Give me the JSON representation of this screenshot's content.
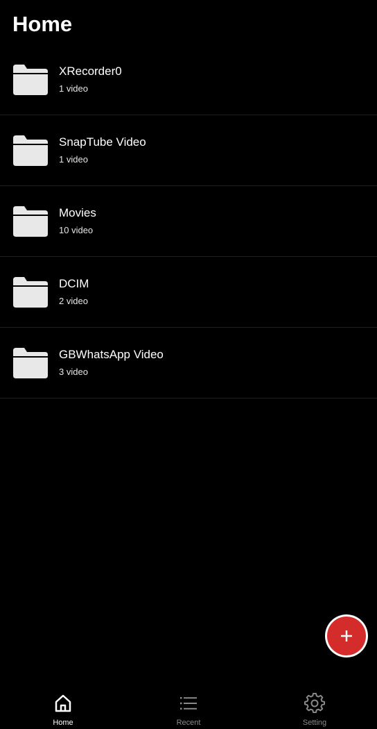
{
  "header": {
    "title": "Home"
  },
  "folders": [
    {
      "name": "XRecorder0",
      "count": "1 video",
      "icon": "folder-icon"
    },
    {
      "name": "SnapTube Video",
      "count": "1 video",
      "icon": "folder-icon"
    },
    {
      "name": "Movies",
      "count": "10 video",
      "icon": "folder-icon"
    },
    {
      "name": "DCIM",
      "count": "2 video",
      "icon": "folder-icon"
    },
    {
      "name": "GBWhatsApp Video",
      "count": "3 video",
      "icon": "folder-icon"
    }
  ],
  "fab": {
    "icon": "plus-icon",
    "color": "#d42b2b"
  },
  "nav": {
    "items": [
      {
        "label": "Home",
        "icon": "home-icon",
        "active": true
      },
      {
        "label": "Recent",
        "icon": "list-icon",
        "active": false
      },
      {
        "label": "Setting",
        "icon": "gear-icon",
        "active": false
      }
    ]
  },
  "colors": {
    "background": "#000000",
    "text": "#ffffff",
    "folder": "#e8e8e8",
    "inactive_nav": "#8a8a8a"
  }
}
